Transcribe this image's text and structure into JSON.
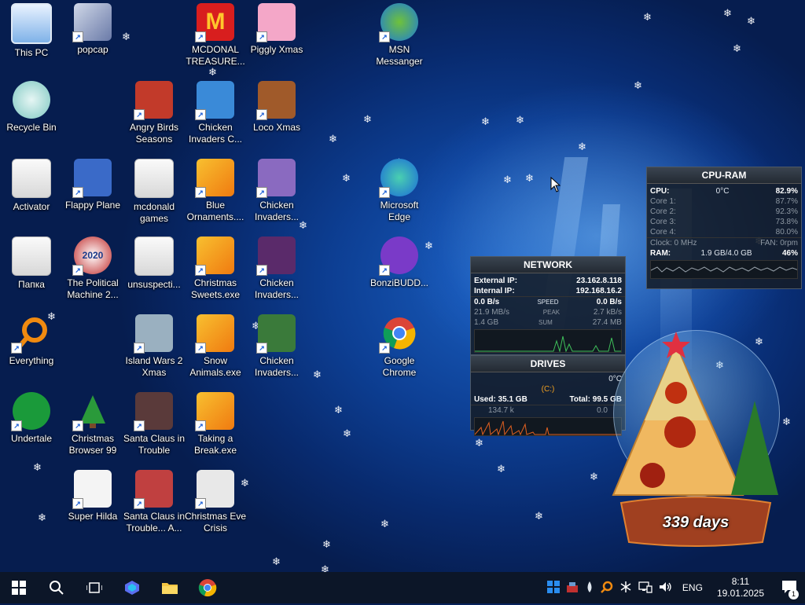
{
  "desktop_icons": [
    {
      "label": "This PC"
    },
    {
      "label": "popcap"
    },
    {
      "label": "MCDONAL TREASURE..."
    },
    {
      "label": "Piggly Xmas"
    },
    {
      "label": "MSN Messanger"
    },
    {
      "label": "Recycle Bin"
    },
    {
      "label": "Angry Birds Seasons"
    },
    {
      "label": "Chicken Invaders C..."
    },
    {
      "label": "Loco Xmas"
    },
    {
      "label": "Activator"
    },
    {
      "label": "Flappy Plane"
    },
    {
      "label": "mcdonald games"
    },
    {
      "label": "Blue Ornaments...."
    },
    {
      "label": "Chicken Invaders..."
    },
    {
      "label": "Microsoft Edge"
    },
    {
      "label": "Папка"
    },
    {
      "label": "The Political Machine 2..."
    },
    {
      "label": "unsuspecti..."
    },
    {
      "label": "Christmas Sweets.exe"
    },
    {
      "label": "Chicken Invaders..."
    },
    {
      "label": "BonziBUDD..."
    },
    {
      "label": "Everything"
    },
    {
      "label": "Island Wars 2 Xmas"
    },
    {
      "label": "Snow Animals.exe"
    },
    {
      "label": "Chicken Invaders..."
    },
    {
      "label": "Google Chrome"
    },
    {
      "label": "Undertale"
    },
    {
      "label": "Christmas Browser 99"
    },
    {
      "label": "Santa Claus in Trouble"
    },
    {
      "label": "Taking a Break.exe"
    },
    {
      "label": "Super Hilda"
    },
    {
      "label": "Santa Claus in Trouble... A..."
    },
    {
      "label": "Christmas Eve Crisis"
    }
  ],
  "cpu_widget": {
    "title": "CPU-RAM",
    "cpu_label": "CPU:",
    "cpu_temp": "0°C",
    "cpu_total": "82.9%",
    "cores": [
      {
        "label": "Core 1:",
        "value": "87.7%"
      },
      {
        "label": "Core 2:",
        "value": "92.3%"
      },
      {
        "label": "Core 3:",
        "value": "73.8%"
      },
      {
        "label": "Core 4:",
        "value": "80.0%"
      }
    ],
    "clock": "Clock: 0 MHz",
    "fan": "FAN: 0rpm",
    "ram_label": "RAM:",
    "ram_value": "1.9 GB/4.0 GB",
    "ram_percent": "46%"
  },
  "network_widget": {
    "title": "NETWORK",
    "external_ip_label": "External IP:",
    "external_ip": "23.162.8.118",
    "internal_ip_label": "Internal IP:",
    "internal_ip": "192.168.16.2",
    "speed_down": "0.0 B/s",
    "speed_label": "SPEED",
    "speed_up": "0.0 B/s",
    "peak_down": "21.9 MB/s",
    "peak_label": "PEAK",
    "peak_up": "2.7 kB/s",
    "sum_down": "1.4 GB",
    "sum_label": "SUM",
    "sum_up": "27.4 MB"
  },
  "drives_widget": {
    "title": "DRIVES",
    "temp": "0°C",
    "drive": "(C:)",
    "used": "Used: 35.1 GB",
    "total": "Total: 99.5 GB",
    "read": "134.7 k",
    "write": "0.0"
  },
  "countdown": {
    "text": "339 days"
  },
  "taskbar": {
    "language": "ENG",
    "time": "8:11",
    "date": "19.01.2025",
    "notifications": "1"
  }
}
